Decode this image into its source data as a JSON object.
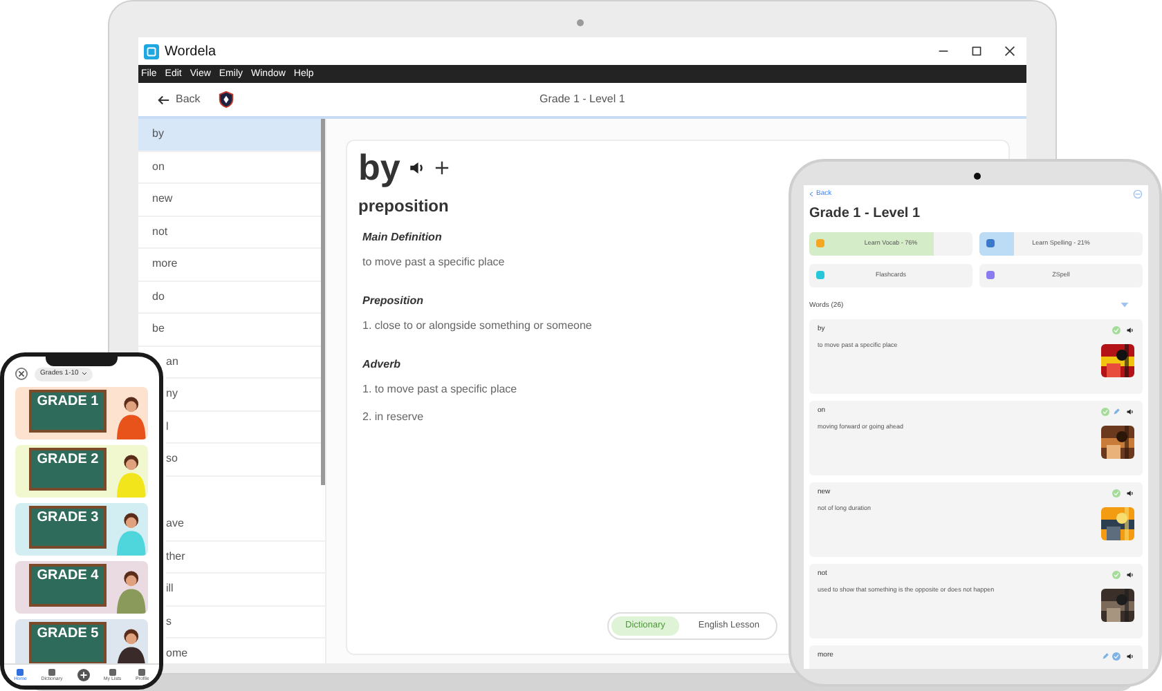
{
  "laptop": {
    "window": {
      "title": "Wordela"
    },
    "menu": [
      "File",
      "Edit",
      "View",
      "Emily",
      "Window",
      "Help"
    ],
    "header": {
      "back": "Back",
      "title": "Grade 1 - Level 1"
    },
    "word_list": [
      {
        "text": "by",
        "selected": true
      },
      {
        "text": "on",
        "selected": false
      },
      {
        "text": "new",
        "selected": false
      },
      {
        "text": "not",
        "selected": false
      },
      {
        "text": "more",
        "selected": false
      },
      {
        "text": "do",
        "selected": false
      },
      {
        "text": "be",
        "selected": false
      },
      {
        "text": "an",
        "selected": false
      },
      {
        "text": "ny",
        "selected": false
      },
      {
        "text": "l",
        "selected": false
      },
      {
        "text": "so",
        "selected": false
      },
      {
        "text": "ave",
        "selected": false
      },
      {
        "text": "ther",
        "selected": false
      },
      {
        "text": "ill",
        "selected": false
      },
      {
        "text": "s",
        "selected": false
      },
      {
        "text": "ome",
        "selected": false
      }
    ],
    "entry": {
      "word": "by",
      "part_of_speech": "preposition",
      "sections": [
        {
          "heading": "Main Definition",
          "lines": [
            "to move past a specific place"
          ]
        },
        {
          "heading": "Preposition",
          "lines": [
            "1. close to or alongside something or someone"
          ]
        },
        {
          "heading": "Adverb",
          "lines": [
            "1. to move past a specific place",
            "2. in reserve"
          ]
        }
      ]
    },
    "toggle": [
      {
        "label": "Dictionary",
        "selected": true
      },
      {
        "label": "English Lesson",
        "selected": false
      }
    ]
  },
  "tablet": {
    "back": "Back",
    "title": "Grade 1 - Level 1",
    "actions": [
      {
        "label": "Learn Vocab - 76%",
        "level": 0.76,
        "color": "#d5ecc8"
      },
      {
        "label": "Learn Spelling - 21%",
        "level": 0.21,
        "color": "#bcdcf5"
      },
      {
        "label": "Flashcards"
      },
      {
        "label": "ZSpell"
      }
    ],
    "words_heading": "Words (26)",
    "words": [
      {
        "word": "by",
        "definition": "to move past a specific place",
        "vocab_done": true,
        "in_progress": false,
        "spelling_done": false
      },
      {
        "word": "on",
        "definition": "moving forward or going ahead",
        "vocab_done": true,
        "in_progress": true,
        "spelling_done": false
      },
      {
        "word": "new",
        "definition": "not of long duration",
        "vocab_done": true,
        "in_progress": false,
        "spelling_done": false
      },
      {
        "word": "not",
        "definition": "used to show that something is the opposite or does not happen",
        "vocab_done": true,
        "in_progress": false,
        "spelling_done": false
      },
      {
        "word": "more",
        "vocab_done": false,
        "in_progress": true,
        "spelling_done": true
      }
    ]
  },
  "phone": {
    "filter": "Grades 1-10",
    "grades": [
      {
        "label": "GRADE 1",
        "color": "#fde3cf"
      },
      {
        "label": "GRADE 2",
        "color": "#f1f8d0"
      },
      {
        "label": "GRADE 3",
        "color": "#d3eef3"
      },
      {
        "label": "GRADE 4",
        "color": "#eadbe2"
      },
      {
        "label": "GRADE 5",
        "color": "#dde6ee"
      }
    ],
    "tabs": [
      {
        "label": "Home",
        "selected": true
      },
      {
        "label": "Dictionary",
        "selected": false
      },
      {
        "label": "My Lists",
        "selected": false
      },
      {
        "label": "Profile",
        "selected": false
      }
    ]
  }
}
